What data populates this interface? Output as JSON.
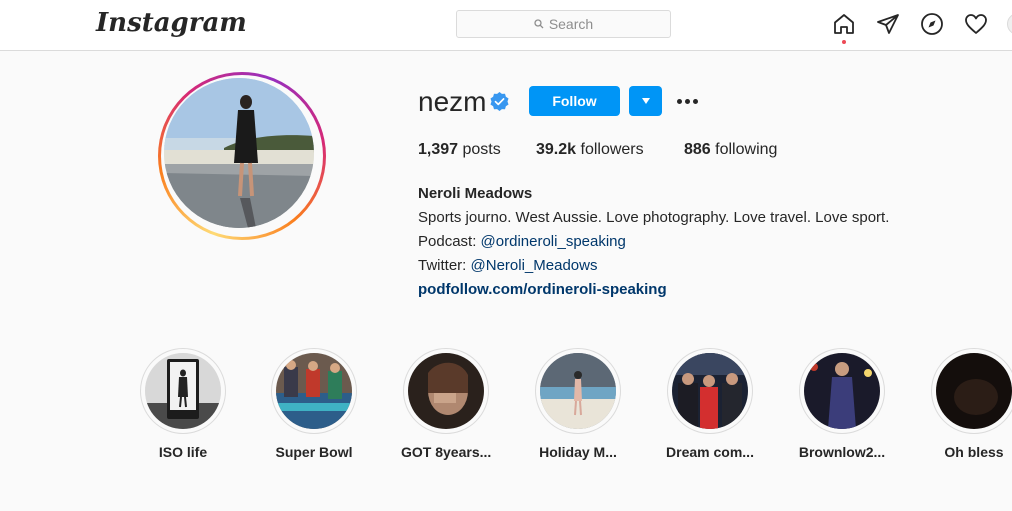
{
  "nav": {
    "logo": "Instagram",
    "search_placeholder": "Search",
    "icons": [
      "home-icon",
      "direct-icon",
      "explore-icon",
      "activity-icon",
      "profile-avatar"
    ]
  },
  "profile": {
    "username": "nezm",
    "verified": true,
    "follow_label": "Follow",
    "stats": {
      "posts_count": "1,397",
      "posts_label": "posts",
      "followers_count": "39.2k",
      "followers_label": "followers",
      "following_count": "886",
      "following_label": "following"
    },
    "bio": {
      "name": "Neroli Meadows",
      "line1": "Sports journo. West Aussie. Love photography. Love travel. Love sport.",
      "line2_prefix": "Podcast: ",
      "line2_mention": "@ordineroli_speaking",
      "line3_prefix": "Twitter: ",
      "line3_mention": "@Neroli_Meadows",
      "link": "podfollow.com/ordineroli-speaking"
    }
  },
  "highlights": [
    {
      "label": "ISO life"
    },
    {
      "label": "Super Bowl"
    },
    {
      "label": "GOT 8years..."
    },
    {
      "label": "Holiday M..."
    },
    {
      "label": "Dream com..."
    },
    {
      "label": "Brownlow2..."
    },
    {
      "label": "Oh bless"
    }
  ],
  "colors": {
    "accent": "#0095f6",
    "link": "#00376b",
    "notification_dot": "#ed4956"
  }
}
